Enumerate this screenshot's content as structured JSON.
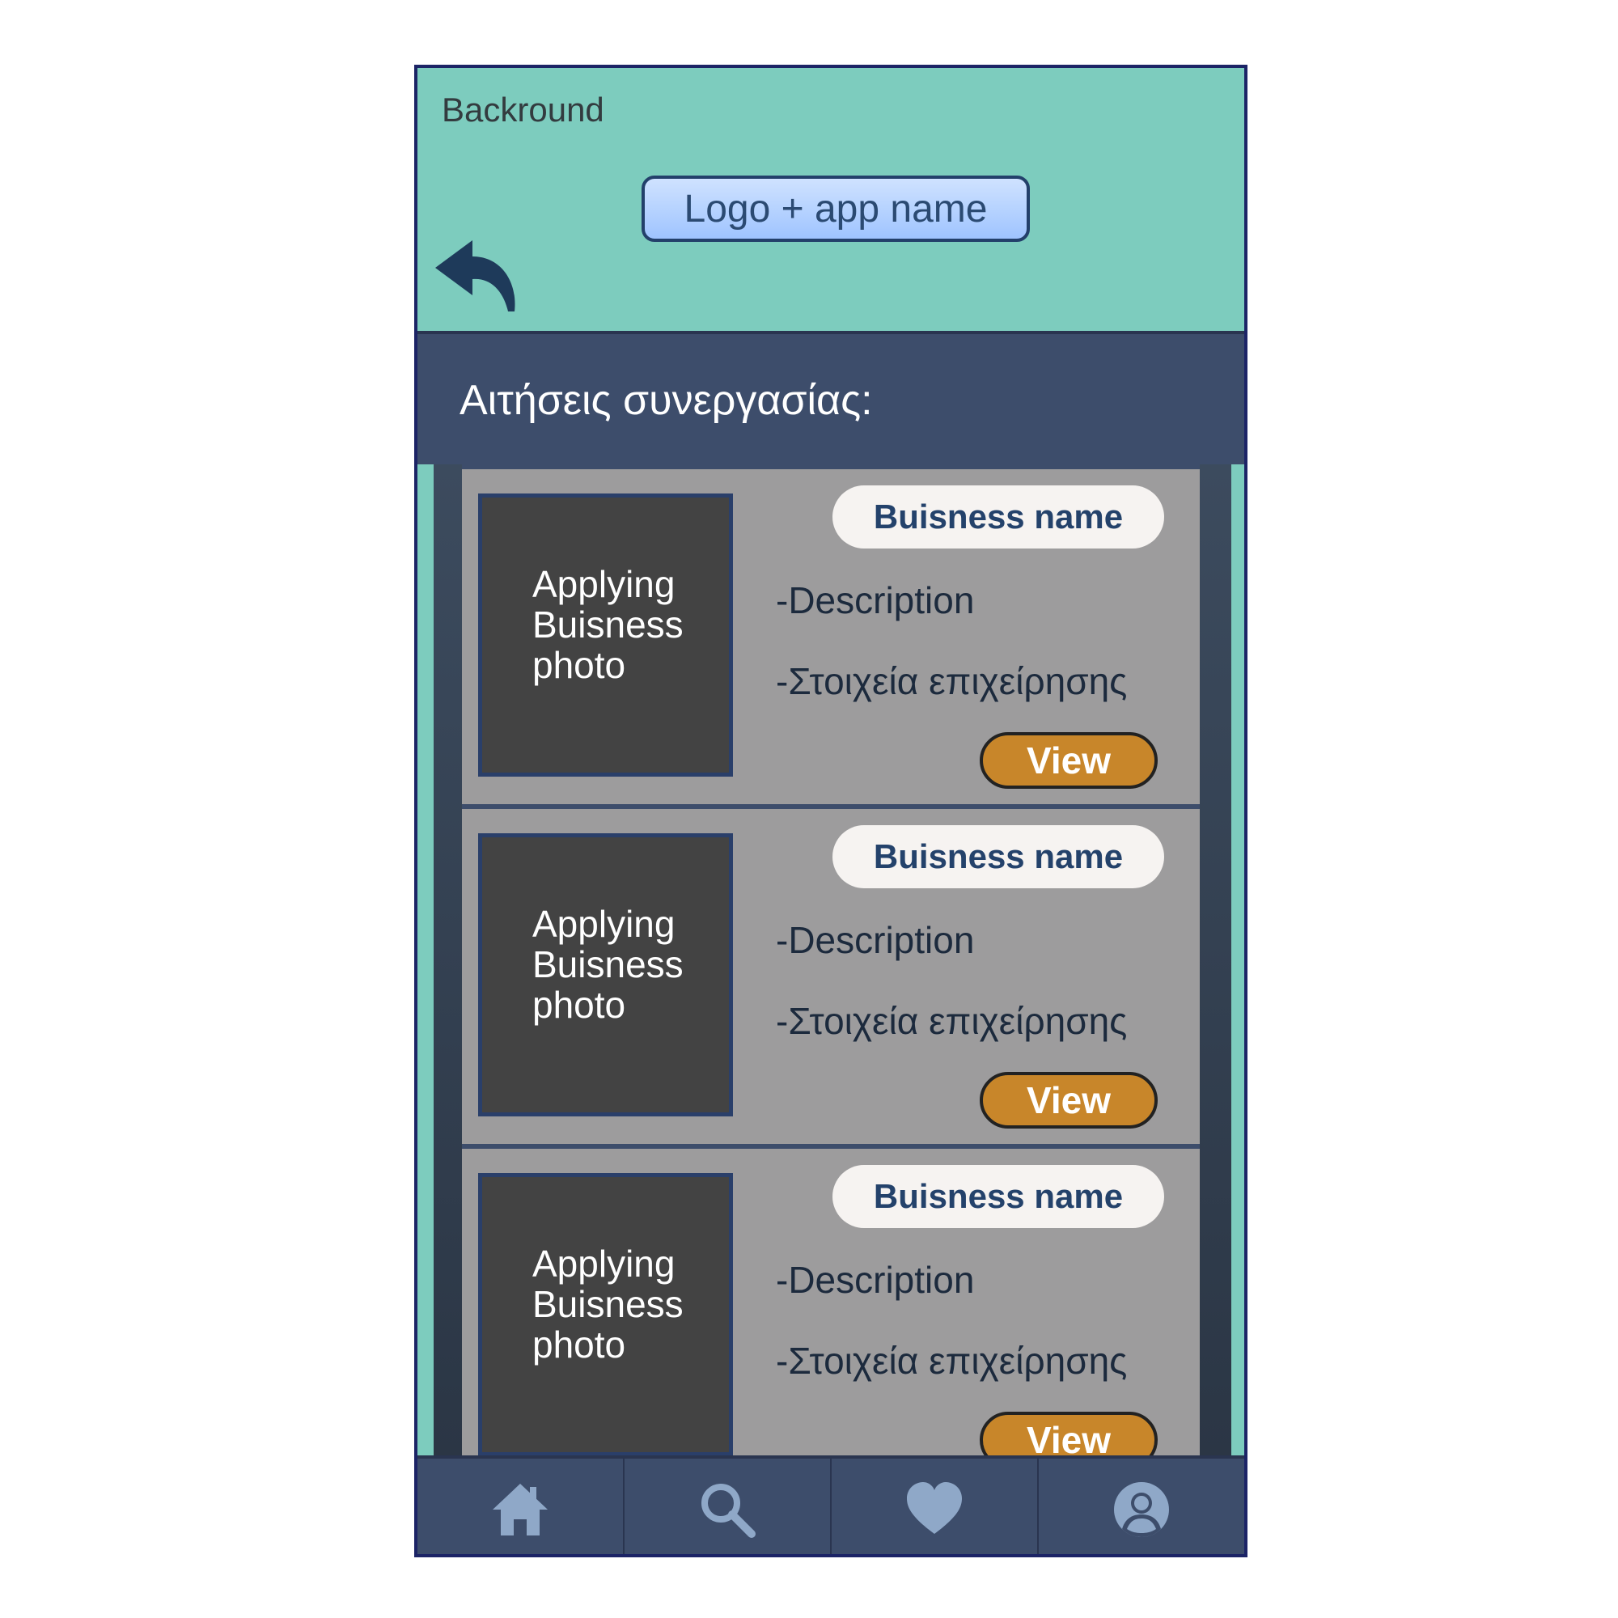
{
  "header": {
    "background_label": "Backround",
    "logo_label": "Logo + app name",
    "colors": {
      "header_bg": "#7dccbe",
      "logo_bg": "#a9cbff"
    }
  },
  "title_bar": {
    "title": "Αιτήσεις συνεργασίας:"
  },
  "cards": [
    {
      "photo_label": [
        "Applying",
        "Buisness",
        "photo"
      ],
      "name": "Buisness name",
      "description": "-Description",
      "details": "-Στοιχεία επιχείρησης",
      "view_label": "View"
    },
    {
      "photo_label": [
        "Applying",
        "Buisness",
        "photo"
      ],
      "name": "Buisness name",
      "description": "-Description",
      "details": "-Στοιχεία επιχείρησης",
      "view_label": "View"
    },
    {
      "photo_label": [
        "Applying",
        "Buisness",
        "photo"
      ],
      "name": "Buisness name",
      "description": "-Description",
      "details": "-Στοιχεία επιχείρησης",
      "view_label": "View"
    }
  ],
  "nav": {
    "items": [
      {
        "icon": "home-icon"
      },
      {
        "icon": "search-icon"
      },
      {
        "icon": "heart-icon"
      },
      {
        "icon": "user-icon"
      }
    ],
    "icon_color": "#8fa8c8"
  },
  "colors": {
    "accent": "#c8862a",
    "dark_bar": "#3d4d6b",
    "card_bg": "#9d9c9d"
  }
}
